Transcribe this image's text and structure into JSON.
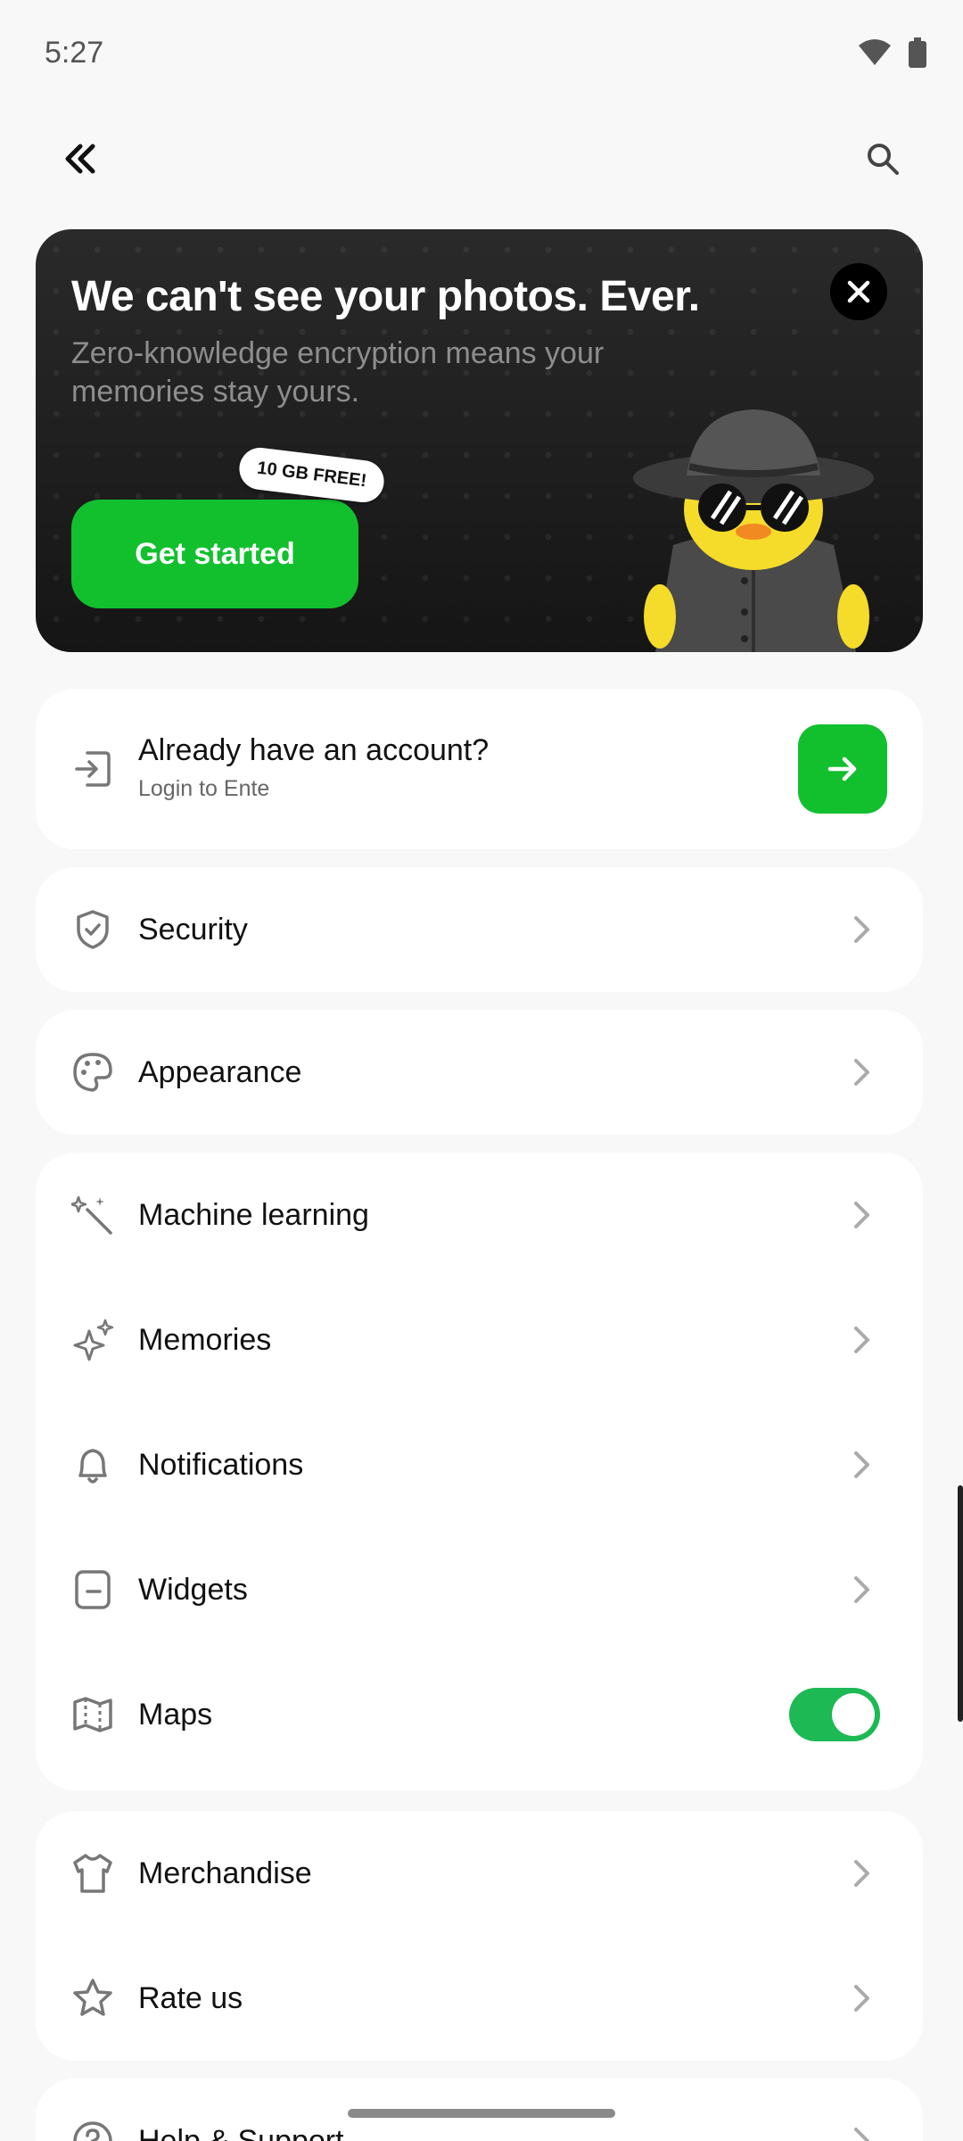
{
  "status_bar": {
    "time": "5:27",
    "icons": [
      "wifi-icon",
      "battery-icon"
    ]
  },
  "top_bar": {
    "back_icon": "double-chevron-left-icon",
    "search_icon": "search-icon"
  },
  "promo": {
    "title": "We can't see your photos. Ever.",
    "subtitle": "Zero-knowledge encryption means your memories stay yours.",
    "badge": "10 GB FREE!",
    "cta_label": "Get started",
    "close_icon": "close-icon",
    "accent": "#12c02e"
  },
  "account": {
    "title": "Already have an account?",
    "subtitle": "Login to Ente",
    "icon": "login-icon",
    "go_icon": "arrow-right-icon"
  },
  "settings": {
    "security": {
      "label": "Security",
      "icon": "shield-check-icon"
    },
    "appearance": {
      "label": "Appearance",
      "icon": "palette-icon"
    },
    "group_features": [
      {
        "label": "Machine learning",
        "icon": "magic-wand-icon"
      },
      {
        "label": "Memories",
        "icon": "sparkle-icon"
      },
      {
        "label": "Notifications",
        "icon": "bell-icon"
      },
      {
        "label": "Widgets",
        "icon": "widget-icon"
      }
    ],
    "maps": {
      "label": "Maps",
      "icon": "map-icon",
      "enabled": true,
      "toggle_color": "#1db954"
    },
    "group_extra": [
      {
        "label": "Merchandise",
        "icon": "shirt-icon"
      },
      {
        "label": "Rate us",
        "icon": "star-icon"
      }
    ],
    "help": {
      "label": "Help & Support",
      "icon": "help-icon"
    }
  }
}
